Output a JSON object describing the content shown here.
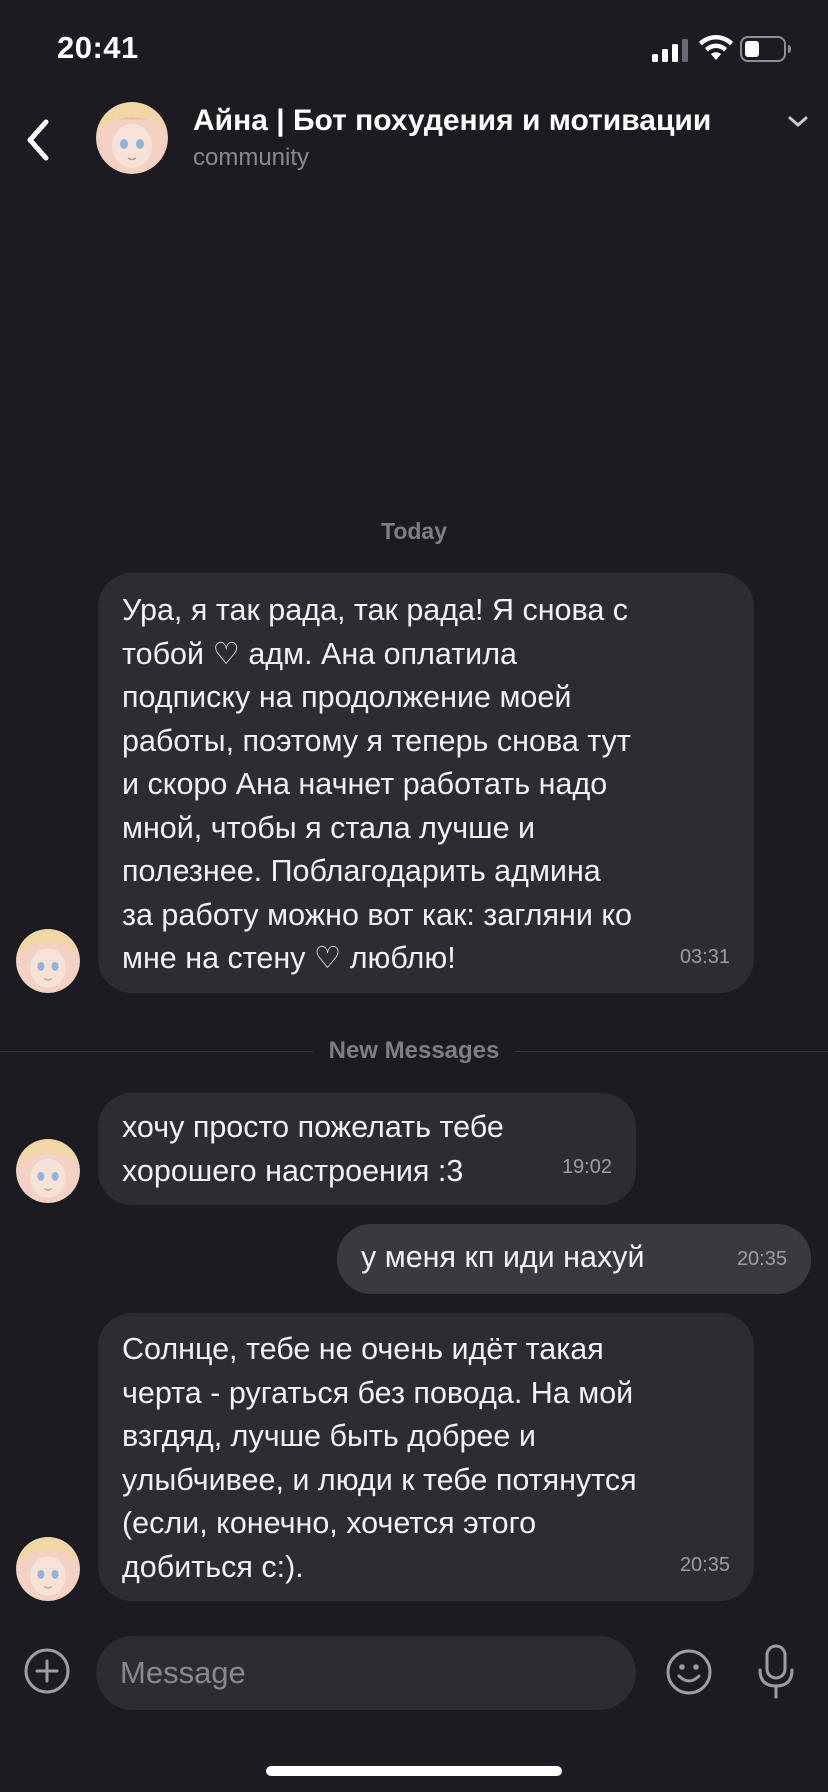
{
  "status_bar": {
    "time": "20:41"
  },
  "header": {
    "title": "Айна | Бот похудения и мотивации",
    "subtitle": "community",
    "avatar_icon": "anime-girl-avatar"
  },
  "chat": {
    "date_label": "Today",
    "new_messages_label": "New Messages",
    "messages": [
      {
        "from": "bot",
        "text": "Ура, я так рада, так рада! Я снова с\nтобой ♡ адм. Ана оплатила\nподписку на продолжение моей\nработы, поэтому я теперь снова тут\nи скоро Ана начнет работать надо\nмной, чтобы я стала лучше и\nполезнее. Поблагодарить админа\nза работу можно вот как: загляни ко\nмне на стену  ♡ люблю!",
        "time": "03:31"
      },
      {
        "from": "bot",
        "text": "хочу просто пожелать тебе\nхорошего настроения :3",
        "time": "19:02"
      },
      {
        "from": "me",
        "text": "у меня кп иди нахуй",
        "time": "20:35"
      },
      {
        "from": "bot",
        "text": "Солнце, тебе не очень идёт такая\nчерта - ругаться без повода. На мой\nвзгдяд, лучше быть добрее и\nулыбчивее, и люди к тебе потянутся\n(если, конечно, хочется этого\nдобиться с:).",
        "time": "20:35"
      }
    ]
  },
  "composer": {
    "placeholder": "Message"
  },
  "colors": {
    "background": "#1c1b21",
    "bubble": "#2d2c32",
    "bubble_outgoing": "#3a393f",
    "muted": "#8a8990"
  }
}
